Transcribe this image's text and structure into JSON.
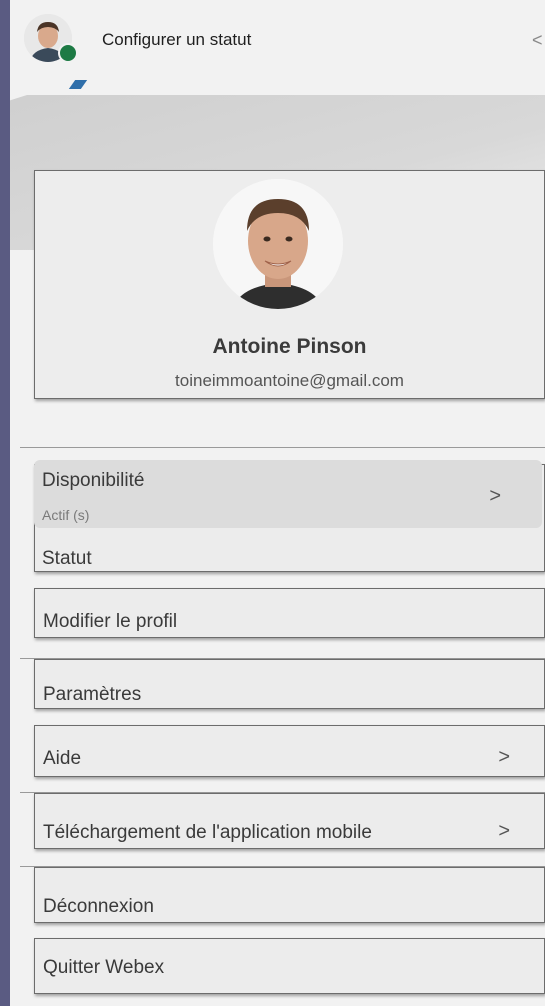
{
  "header": {
    "title": "Configurer un statut",
    "collapse_glyph": "<"
  },
  "profile": {
    "name": "Antoine Pinson",
    "email": "toineimmoantoine@gmail.com"
  },
  "menu": {
    "availability": {
      "label": "Disponibilité",
      "value": "Actif (s)"
    },
    "status": {
      "label": "Statut"
    },
    "edit_profile": {
      "label": "Modifier le profil"
    },
    "settings": {
      "label": "Paramètres"
    },
    "help": {
      "label": "Aide"
    },
    "mobile_download": {
      "label": "Téléchargement de l'application mobile"
    },
    "logout": {
      "label": "Déconnexion"
    },
    "quit": {
      "label": "Quitter Webex"
    }
  },
  "chevron_glyph": ">",
  "colors": {
    "status_active": "#1d7a44",
    "background": "#5a5b82",
    "panel": "#f2f2f2"
  }
}
